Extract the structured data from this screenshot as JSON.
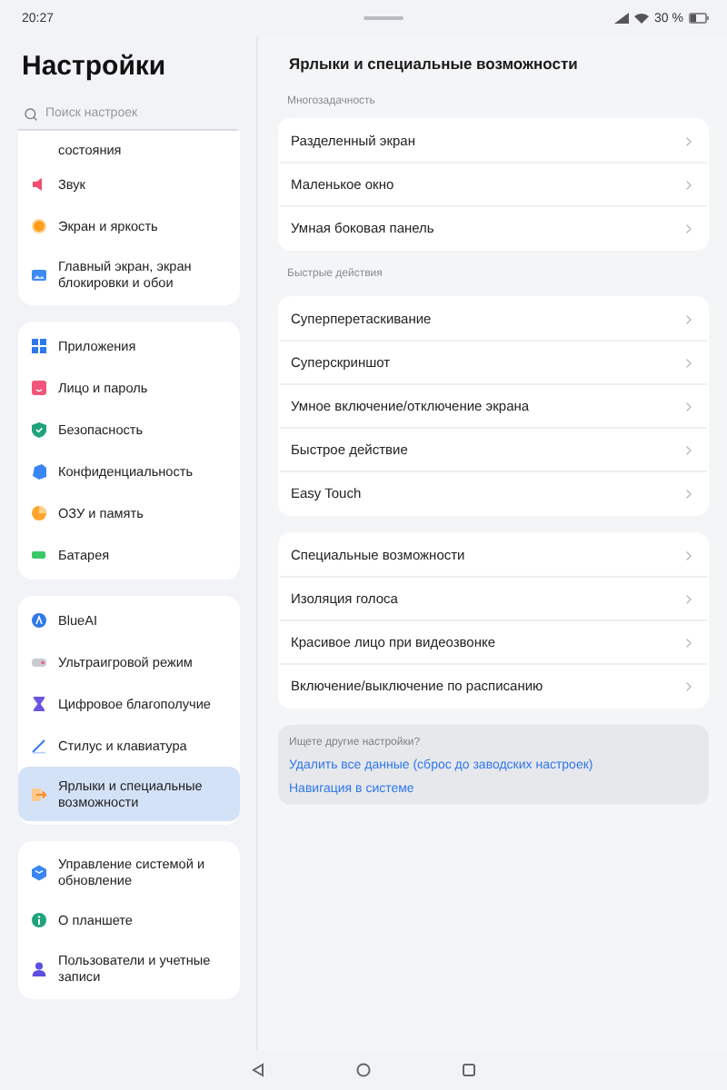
{
  "status_bar": {
    "time": "20:27",
    "battery": "30 %"
  },
  "sidebar": {
    "title": "Настройки",
    "search": {
      "placeholder": "Поиск настроек"
    },
    "groups": [
      {
        "items": [
          {
            "label": "состояния",
            "selected": false
          },
          {
            "label": "Звук",
            "selected": false
          },
          {
            "label": "Экран и яркость",
            "selected": false
          },
          {
            "label": "Главный экран, экран блокировки и обои",
            "selected": false
          }
        ]
      },
      {
        "items": [
          {
            "label": "Приложения",
            "selected": false
          },
          {
            "label": "Лицо и пароль",
            "selected": false
          },
          {
            "label": "Безопасность",
            "selected": false
          },
          {
            "label": "Конфиденциальность",
            "selected": false
          },
          {
            "label": "ОЗУ и память",
            "selected": false
          },
          {
            "label": "Батарея",
            "selected": false
          }
        ]
      },
      {
        "items": [
          {
            "label": "BlueAI",
            "selected": false
          },
          {
            "label": "Ультраигровой режим",
            "selected": false
          },
          {
            "label": "Цифровое благополучие",
            "selected": false
          },
          {
            "label": "Стилус и клавиатура",
            "selected": false
          },
          {
            "label": "Ярлыки и специальные возможности",
            "selected": true
          }
        ]
      },
      {
        "items": [
          {
            "label": "Управление системой и обновление",
            "selected": false
          },
          {
            "label": "О планшете",
            "selected": false
          },
          {
            "label": "Пользователи и учетные записи",
            "selected": false
          }
        ]
      }
    ]
  },
  "detail": {
    "title": "Ярлыки и специальные возможности",
    "sections": [
      {
        "heading": "Многозадачность",
        "items": [
          "Разделенный экран",
          "Маленькое окно",
          "Умная боковая панель"
        ]
      },
      {
        "heading": "Быстрые действия",
        "items": [
          "Суперперетаскивание",
          "Суперскриншот",
          "Умное включение/отключение экрана",
          "Быстрое действие",
          "Easy Touch"
        ]
      },
      {
        "items": [
          "Специальные возможности",
          "Изоляция голоса",
          "Красивое лицо при видеозвонке",
          "Включение/выключение по расписанию"
        ]
      }
    ],
    "suggestions": {
      "heading": "Ищете другие настройки?",
      "links": [
        "Удалить все данные (сброс до заводских настроек)",
        "Навигация в системе"
      ]
    }
  }
}
